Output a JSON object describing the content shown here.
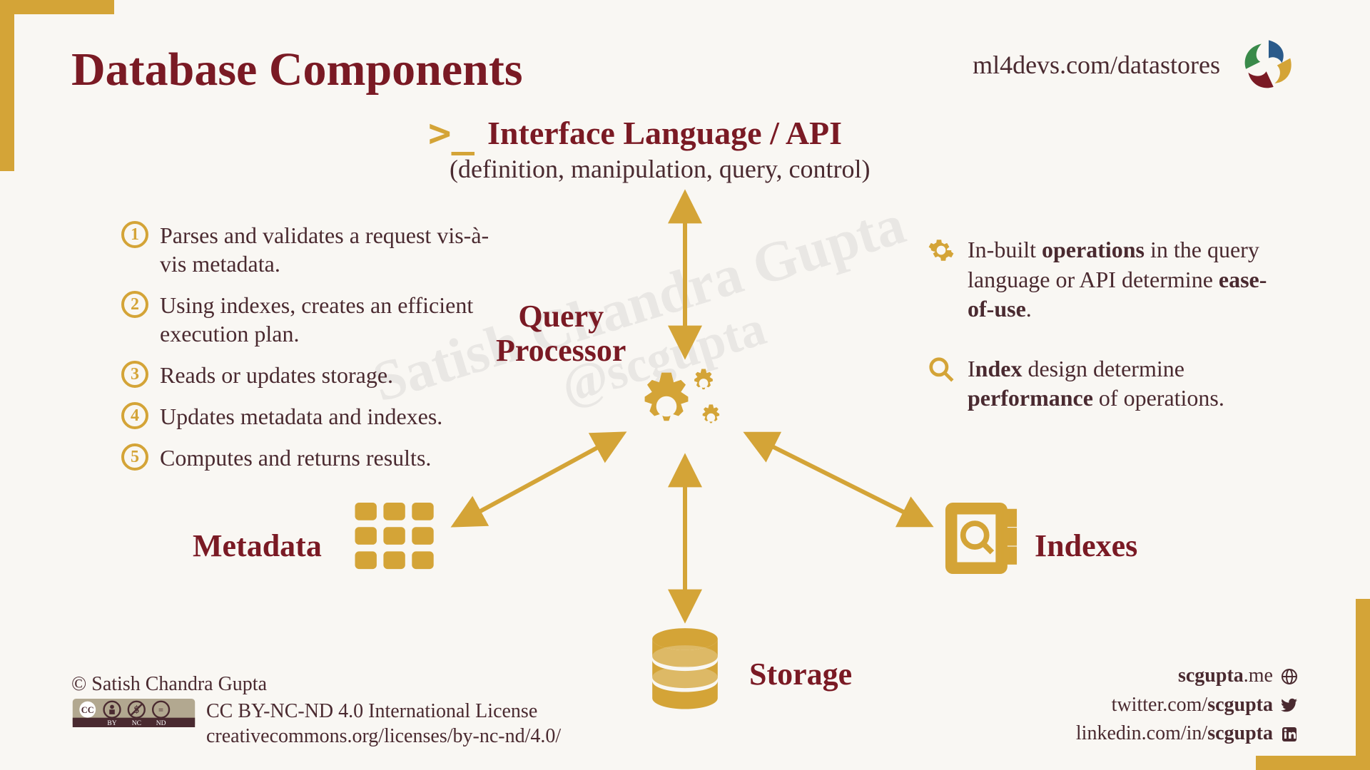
{
  "title": "Database Components",
  "header_url": "ml4devs.com/datastores",
  "interface": {
    "title": "Interface Language / API",
    "subtitle": "(definition, manipulation, query, control)"
  },
  "steps": [
    "Parses and validates a request vis-à-vis metadata.",
    "Using indexes, creates an efficient execution plan.",
    "Reads or updates storage.",
    "Updates metadata and indexes.",
    "Computes and returns results."
  ],
  "notes": [
    {
      "icon": "gear-icon",
      "pre": "In-built ",
      "bold1": "operations",
      "mid": " in the query language or API determine ",
      "bold2": "ease-of-use",
      "post": "."
    },
    {
      "icon": "magnifier-icon",
      "pre": "I",
      "bold1": "ndex",
      "mid": " design determine ",
      "bold2": "performance",
      "post": " of operations."
    }
  ],
  "labels": {
    "query_processor_line1": "Query",
    "query_processor_line2": "Processor",
    "metadata": "Metadata",
    "storage": "Storage",
    "indexes": "Indexes"
  },
  "watermark": {
    "line1": "Satish Chandra Gupta",
    "line2": "@scgupta"
  },
  "footer_left": {
    "copyright": "© Satish Chandra Gupta",
    "license_line1": "CC BY-NC-ND 4.0 International License",
    "license_line2": "creativecommons.org/licenses/by-nc-nd/4.0/"
  },
  "footer_right": {
    "site_pre": "scgupta",
    "site_suf": ".me",
    "twitter_pre": "twitter.com/",
    "twitter_bold": "scgupta",
    "linkedin_pre": "linkedin.com/in/",
    "linkedin_bold": "scgupta"
  },
  "colors": {
    "accent": "#d4a437",
    "heading": "#7a1a24",
    "body": "#4a2a30"
  }
}
